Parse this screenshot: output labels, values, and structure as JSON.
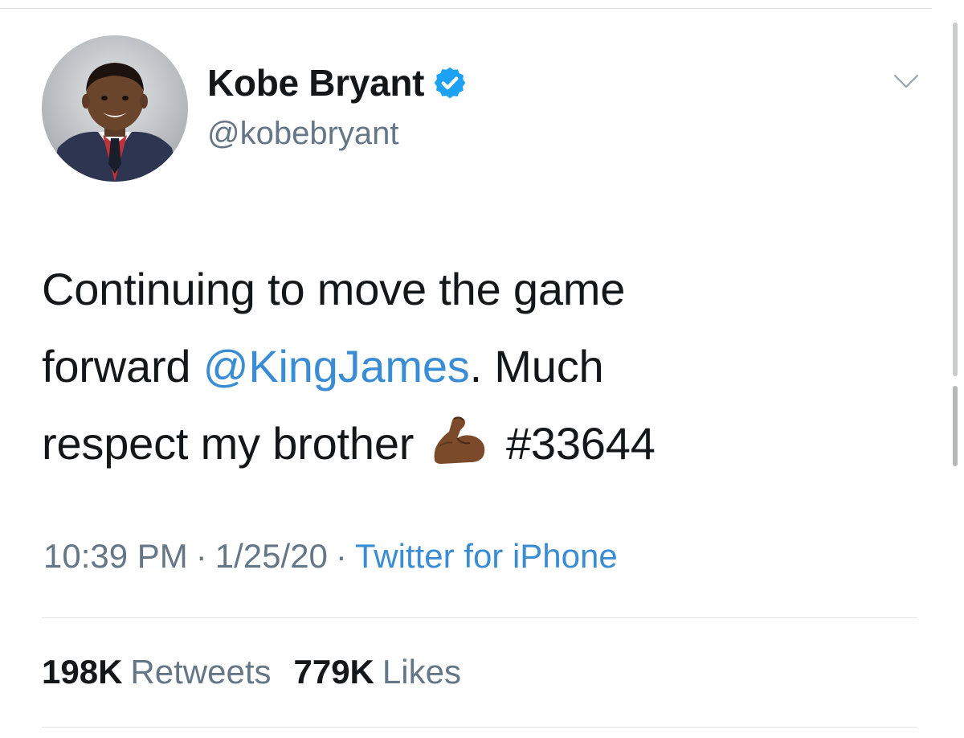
{
  "author": {
    "display_name": "Kobe Bryant",
    "handle": "@kobebryant",
    "verified": true
  },
  "tweet": {
    "text_line1": "Continuing to move the game",
    "text_line2_pre": "forward ",
    "mention": "@KingJames",
    "text_line2_post": ". Much",
    "text_line3_pre": "respect my brother",
    "emoji": "flexed-biceps-medium-dark-skin",
    "hashtag": "#33644"
  },
  "meta": {
    "time": "10:39 PM",
    "separator": "·",
    "date": "1/25/20",
    "source": "Twitter for iPhone"
  },
  "stats": {
    "retweets_count": "198K",
    "retweets_label": "Retweets",
    "likes_count": "779K",
    "likes_label": "Likes"
  },
  "colors": {
    "link": "#3a8dd4",
    "secondary_text": "#657786",
    "primary_text": "#14171a",
    "verified_badge": "#1da1f2"
  }
}
